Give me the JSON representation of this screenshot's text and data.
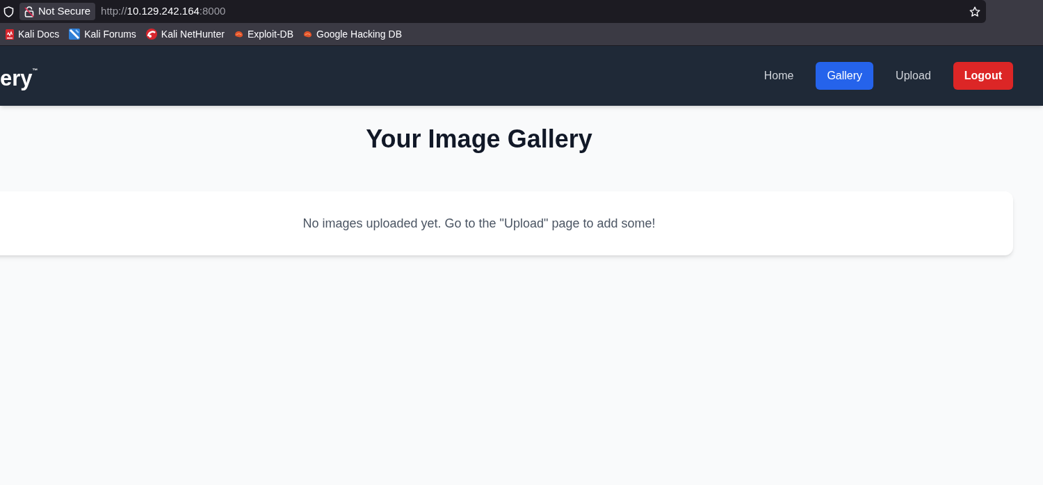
{
  "browser": {
    "security_label": "Not Secure",
    "url": {
      "scheme": "http://",
      "host": "10.129.242.164",
      "port": ":8000"
    },
    "bookmarks": [
      {
        "label": "Kali Docs",
        "kind": "docs"
      },
      {
        "label": "Kali Forums",
        "kind": "forums"
      },
      {
        "label": "Kali NetHunter",
        "kind": "nethunter"
      },
      {
        "label": "Exploit-DB",
        "kind": "bug"
      },
      {
        "label": "Google Hacking DB",
        "kind": "bug"
      }
    ]
  },
  "navbar": {
    "brand": "ery$^{™}$",
    "links": [
      {
        "label": "Home",
        "kind": "link",
        "selected": false
      },
      {
        "label": "Gallery",
        "kind": "link",
        "selected": true
      },
      {
        "label": "Upload",
        "kind": "link",
        "selected": false
      },
      {
        "label": "Logout",
        "kind": "danger",
        "selected": false
      }
    ]
  },
  "page": {
    "title": "Your Image Gallery",
    "empty_message": "No images uploaded yet. Go to the \"Upload\" page to add some!"
  }
}
